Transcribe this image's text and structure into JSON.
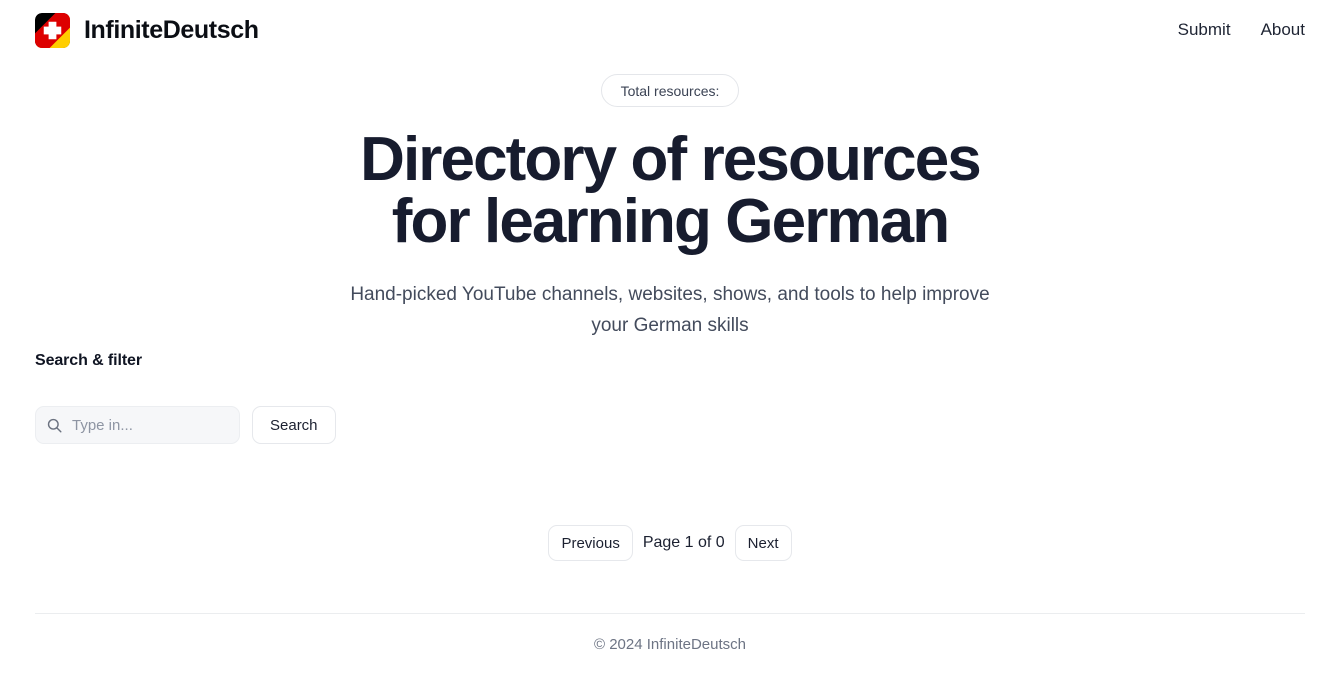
{
  "header": {
    "brand": {
      "logo_icon": "german-swiss-flag-logo",
      "name": "InfiniteDeutsch",
      "logo_colors": {
        "black": "#000000",
        "red": "#dd0000",
        "yellow": "#ffce00",
        "cross": "#ffffff"
      }
    },
    "nav": [
      {
        "label": "Submit",
        "name": "nav-link-submit"
      },
      {
        "label": "About",
        "name": "nav-link-about"
      }
    ]
  },
  "hero": {
    "badge": "Total resources:",
    "title_line1": "Directory of resources",
    "title_line2": "for learning German",
    "subtitle": "Hand-picked YouTube channels, websites, shows, and tools to help improve your German skills",
    "title_color": "#171c2e"
  },
  "filters": {
    "section_title": "Search & filter",
    "search_icon": "search-icon",
    "search_value": "",
    "search_placeholder": "Type in...",
    "search_button": "Search"
  },
  "pagination": {
    "previous": "Previous",
    "status": "Page 1 of 0",
    "next": "Next"
  },
  "footer": {
    "copyright": "© 2024 InfiniteDeutsch"
  }
}
